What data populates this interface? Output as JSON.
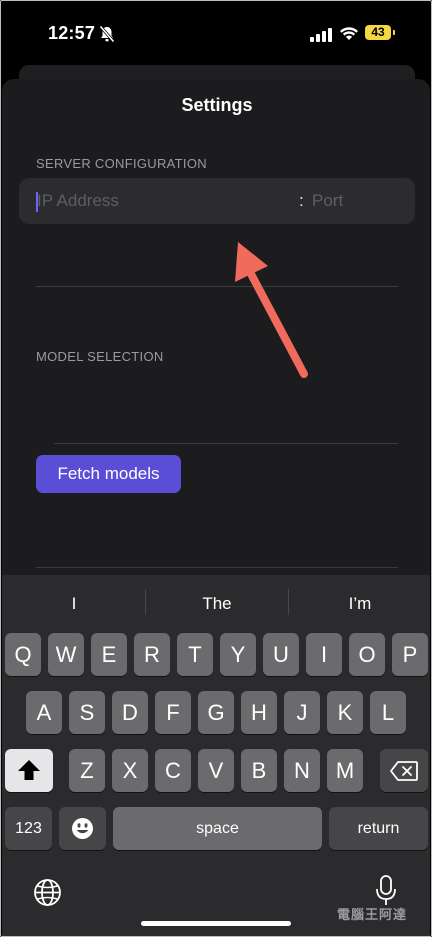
{
  "status_bar": {
    "time": "12:57",
    "battery_level": "43",
    "icons": [
      "bell-slash-icon",
      "signal-icon",
      "wifi-icon",
      "battery-icon"
    ]
  },
  "settings": {
    "title": "Settings",
    "server_section_label": "SERVER CONFIGURATION",
    "ip_placeholder": "IP Address",
    "separator": ":",
    "port_placeholder": "Port",
    "model_section_label": "MODEL SELECTION",
    "fetch_button_label": "Fetch models"
  },
  "annotation": {
    "arrow_color": "#f06b5b",
    "target": "ip-address-input"
  },
  "keyboard": {
    "predictions": [
      "I",
      "The",
      "I’m"
    ],
    "row1": [
      "Q",
      "W",
      "E",
      "R",
      "T",
      "Y",
      "U",
      "I",
      "O",
      "P"
    ],
    "row2": [
      "A",
      "S",
      "D",
      "F",
      "G",
      "H",
      "J",
      "K",
      "L"
    ],
    "row3": [
      "Z",
      "X",
      "C",
      "V",
      "B",
      "N",
      "M"
    ],
    "numbers_label": "123",
    "space_label": "space",
    "return_label": "return",
    "icons": [
      "shift-icon",
      "delete-icon",
      "emoji-icon",
      "globe-icon",
      "microphone-icon"
    ]
  },
  "colors": {
    "accent": "#5b4ed6",
    "caret": "#6d62ff",
    "battery": "#f5d742",
    "sheet_bg": "#1c1c1e",
    "keyboard_bg": "#2b2b2d"
  },
  "watermark": "電腦王阿達"
}
